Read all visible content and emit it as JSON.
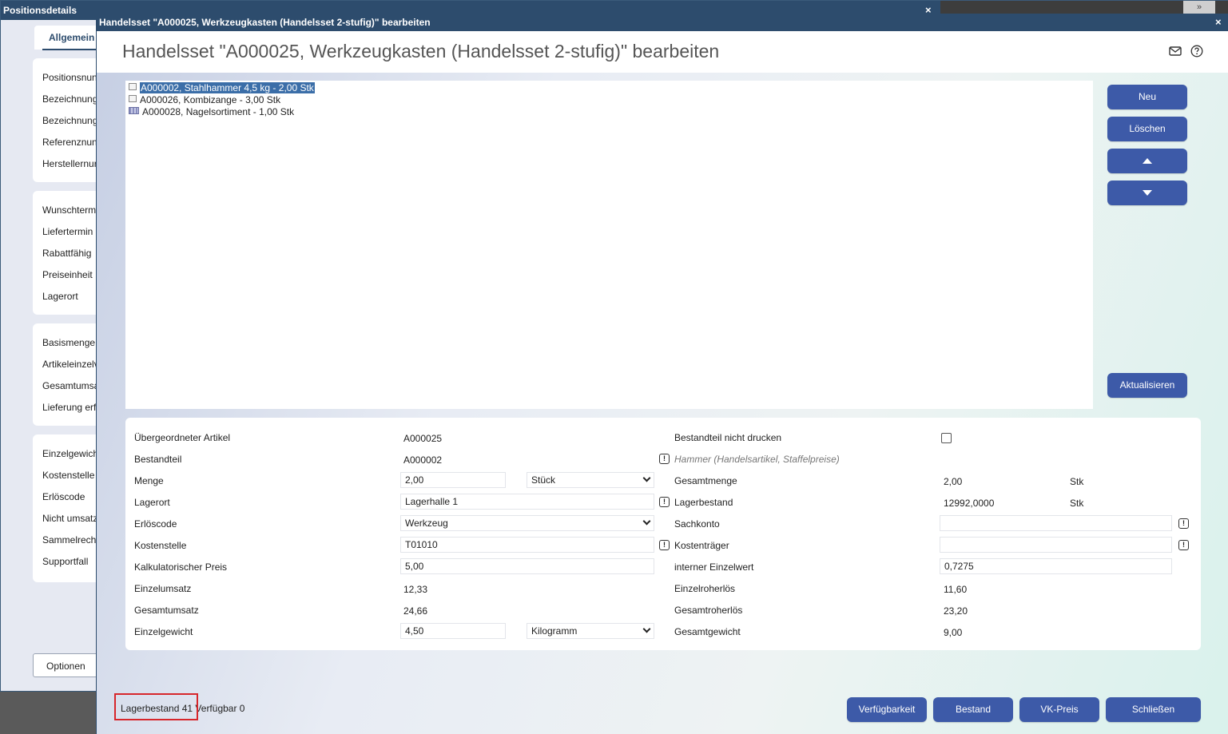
{
  "background_window": {
    "title": "Positionsdetails",
    "close": "×",
    "strip_button": "»",
    "tab_label": "Allgemein",
    "groups": [
      [
        "Positionsnun",
        "Bezeichnung",
        "Bezeichnung",
        "Referenznun",
        "Herstellernur"
      ],
      [
        "Wunschterm",
        "Liefertermin",
        "Rabattfähig",
        "Preiseinheit",
        "Lagerort"
      ],
      [
        "Basismenge",
        "Artikeleinzelv",
        "Gesamtumsa",
        "Lieferung erf"
      ],
      [
        "Einzelgewich",
        "Kostenstelle",
        "Erlöscode",
        "Nicht umsatz",
        "Sammelrech",
        "Supportfall"
      ]
    ],
    "options_button": "Optionen"
  },
  "dialog": {
    "titlebar": "Handelsset \"A000025, Werkzeugkasten (Handelsset 2-stufig)\" bearbeiten",
    "close": "×",
    "heading": "Handelsset \"A000025, Werkzeugkasten (Handelsset 2-stufig)\" bearbeiten",
    "icons": {
      "mail": "mail-icon",
      "help": "help-icon"
    }
  },
  "tree": {
    "items": [
      {
        "label": "A000002, Stahlhammer 4,5 kg - 2,00 Stk",
        "icon": "article-icon",
        "selected": true
      },
      {
        "label": "A000026, Kombizange - 3,00 Stk",
        "icon": "article-icon",
        "selected": false
      },
      {
        "label": "A000028, Nagelsortiment - 1,00 Stk",
        "icon": "set-icon",
        "selected": false
      }
    ]
  },
  "side_buttons": {
    "new": "Neu",
    "delete": "Löschen",
    "refresh": "Aktualisieren"
  },
  "form": {
    "left": {
      "parent_article": {
        "label": "Übergeordneter Artikel",
        "value": "A000025"
      },
      "component": {
        "label": "Bestandteil",
        "value": "A000002"
      },
      "quantity": {
        "label": "Menge",
        "value": "2,00",
        "unit": "Stück"
      },
      "storage": {
        "label": "Lagerort",
        "value": "Lagerhalle 1"
      },
      "revenue_code": {
        "label": "Erlöscode",
        "value": "Werkzeug"
      },
      "cost_center": {
        "label": "Kostenstelle",
        "value": "T01010"
      },
      "calc_price": {
        "label": "Kalkulatorischer Preis",
        "value": "5,00"
      },
      "unit_revenue": {
        "label": "Einzelumsatz",
        "value": "12,33"
      },
      "total_revenue": {
        "label": "Gesamtumsatz",
        "value": "24,66"
      },
      "unit_weight": {
        "label": "Einzelgewicht",
        "value": "4,50",
        "unit": "Kilogramm"
      }
    },
    "right": {
      "no_print": {
        "label": "Bestandteil nicht drucken",
        "checked": false
      },
      "component_desc": "Hammer (Handelsartikel, Staffelpreise)",
      "total_quantity": {
        "label": "Gesamtmenge",
        "value": "2,00",
        "unit": "Stk"
      },
      "stock": {
        "label": "Lagerbestand",
        "value": "12992,0000",
        "unit": "Stk"
      },
      "account": {
        "label": "Sachkonto",
        "value": ""
      },
      "cost_unit": {
        "label": "Kostenträger",
        "value": ""
      },
      "internal_unit_value": {
        "label": "interner Einzelwert",
        "value": "0,7275"
      },
      "unit_gross_profit": {
        "label": "Einzelroherlös",
        "value": "11,60"
      },
      "total_gross_profit": {
        "label": "Gesamtroherlös",
        "value": "23,20"
      },
      "total_weight": {
        "label": "Gesamtgewicht",
        "value": "9,00"
      }
    }
  },
  "footer": {
    "stock_label": "Lagerbestand 41",
    "available_label": "Verfügbar 0",
    "buttons": {
      "availability": "Verfügbarkeit",
      "stock": "Bestand",
      "sales_price": "VK-Preis",
      "close": "Schließen"
    }
  },
  "colors": {
    "titlebar": "#2d4c6d",
    "button": "#3d5aa8",
    "highlight": "#d7262b",
    "selection": "#3b6ea8"
  }
}
